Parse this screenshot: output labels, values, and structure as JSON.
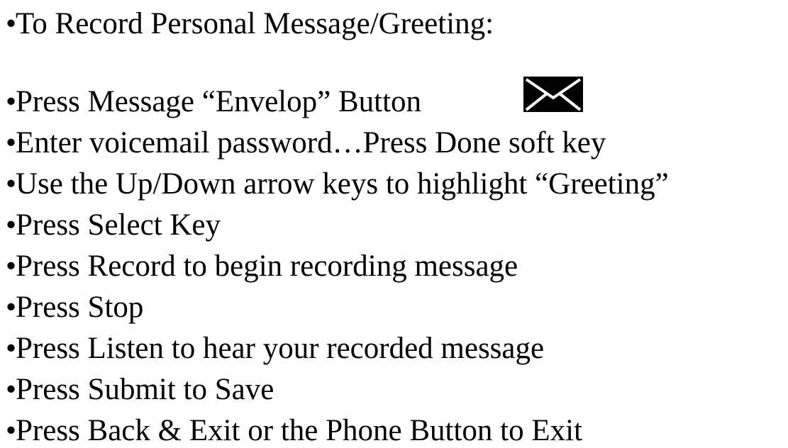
{
  "bullet": "•",
  "heading": "To Record Personal Message/Greeting:",
  "steps": [
    "Press Message “Envelop” Button",
    "Enter voicemail password…Press Done soft key",
    "Use the Up/Down arrow keys to highlight “Greeting”",
    "Press Select Key",
    "Press Record to begin recording message",
    "Press Stop",
    "Press Listen to hear your  recorded message",
    "Press Submit to Save",
    "Press Back & Exit or the Phone Button to Exit"
  ],
  "icons": {
    "message_button": "envelope-icon"
  }
}
